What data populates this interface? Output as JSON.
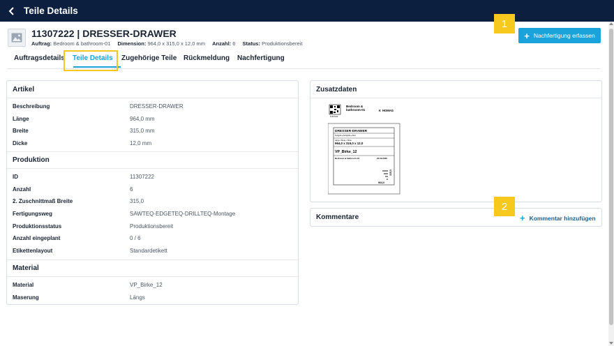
{
  "header": {
    "title": "Teile Details"
  },
  "part": {
    "title": "11307222 | DRESSER-DRAWER",
    "meta": {
      "auftrag_label": "Auftrag:",
      "auftrag_value": "Bedroom & bathroom-01",
      "dimension_label": "Dimension:",
      "dimension_value": "964,0 x 315,0 x 12,0 mm",
      "anzahl_label": "Anzahl:",
      "anzahl_value": "6",
      "status_label": "Status:",
      "status_value": "Produktionsbereit"
    }
  },
  "actions": {
    "nachfertigung": "Nachfertigung erfassen"
  },
  "badges": {
    "one": "1",
    "two": "2"
  },
  "tabs": [
    {
      "label": "Auftragsdetails"
    },
    {
      "label": "Teile Details"
    },
    {
      "label": "Zugehörige Teile"
    },
    {
      "label": "Rückmeldung"
    },
    {
      "label": "Nachfertigung"
    }
  ],
  "artikel": {
    "heading": "Artikel",
    "rows": [
      {
        "label": "Beschreibung",
        "value": "DRESSER-DRAWER"
      },
      {
        "label": "Länge",
        "value": "964,0 mm"
      },
      {
        "label": "Breite",
        "value": "315,0 mm"
      },
      {
        "label": "Dicke",
        "value": "12,0 mm"
      }
    ]
  },
  "produktion": {
    "heading": "Produktion",
    "rows": [
      {
        "label": "ID",
        "value": "11307222"
      },
      {
        "label": "Anzahl",
        "value": "6"
      },
      {
        "label": "2. Zuschnittmaß Breite",
        "value": "315,0"
      },
      {
        "label": "Fertigungsweg",
        "value": "SAWTEQ-EDGETEQ-DRILLTEQ-Montage"
      },
      {
        "label": "Produktionsstatus",
        "value": "Produktionsbereit"
      },
      {
        "label": "Anzahl eingeplant",
        "value": "0 / 6"
      },
      {
        "label": "Etikettenlayout",
        "value": "Standardetikett"
      }
    ]
  },
  "material": {
    "heading": "Material",
    "rows": [
      {
        "label": "Material",
        "value": "VP_Birke_12"
      },
      {
        "label": "Maserung",
        "value": "Längs"
      }
    ]
  },
  "zusatzdaten": {
    "heading": "Zusatzdaten",
    "label_preview": {
      "project_line1": "Bedroom &",
      "project_line2": "bathroom-01",
      "brand": "HOMAG",
      "code": "11307222",
      "part_name": "DRESSER-DRAWER",
      "part_sub": "Fertigteil ▸ Fertigteile ▸ Drwr",
      "dims_caption": "Länge x Breite x Dicke",
      "dims": "964,0 x 315,0 x 12,0",
      "material": "VP_Birke_12",
      "order": "Bedroom & bathroom-01",
      "date": "23.09.2025",
      "edge_right": "315,0",
      "edge_bottom": "964,0"
    }
  },
  "kommentare": {
    "heading": "Kommentare",
    "add_label": "Kommentar hinzufügen"
  }
}
